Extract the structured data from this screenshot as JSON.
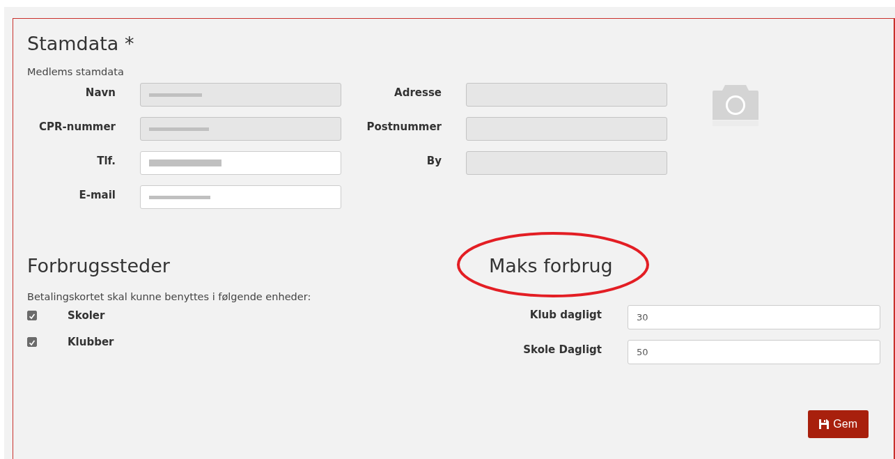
{
  "stamdata": {
    "title": "Stamdata *",
    "subtitle": "Medlems stamdata",
    "fields_left": [
      {
        "label": "Navn",
        "disabled": true,
        "redacted": true
      },
      {
        "label": "CPR-nummer",
        "disabled": true,
        "redacted": true
      },
      {
        "label": "Tlf.",
        "disabled": false,
        "redacted": true
      },
      {
        "label": "E-mail",
        "disabled": false,
        "redacted": true
      }
    ],
    "fields_right": [
      {
        "label": "Adresse",
        "disabled": true
      },
      {
        "label": "Postnummer",
        "disabled": true
      },
      {
        "label": "By",
        "disabled": true
      }
    ]
  },
  "forbrugssteder": {
    "title": "Forbrugssteder",
    "description": "Betalingskortet skal kunne benyttes i følgende enheder:",
    "options": [
      {
        "label": "Skoler",
        "checked": true
      },
      {
        "label": "Klubber",
        "checked": true
      }
    ]
  },
  "maks_forbrug": {
    "title": "Maks forbrug",
    "circled": true,
    "fields": [
      {
        "label": "Klub dagligt",
        "value": "30"
      },
      {
        "label": "Skole Dagligt",
        "value": "50"
      }
    ]
  },
  "save_button": {
    "label": "Gem"
  }
}
